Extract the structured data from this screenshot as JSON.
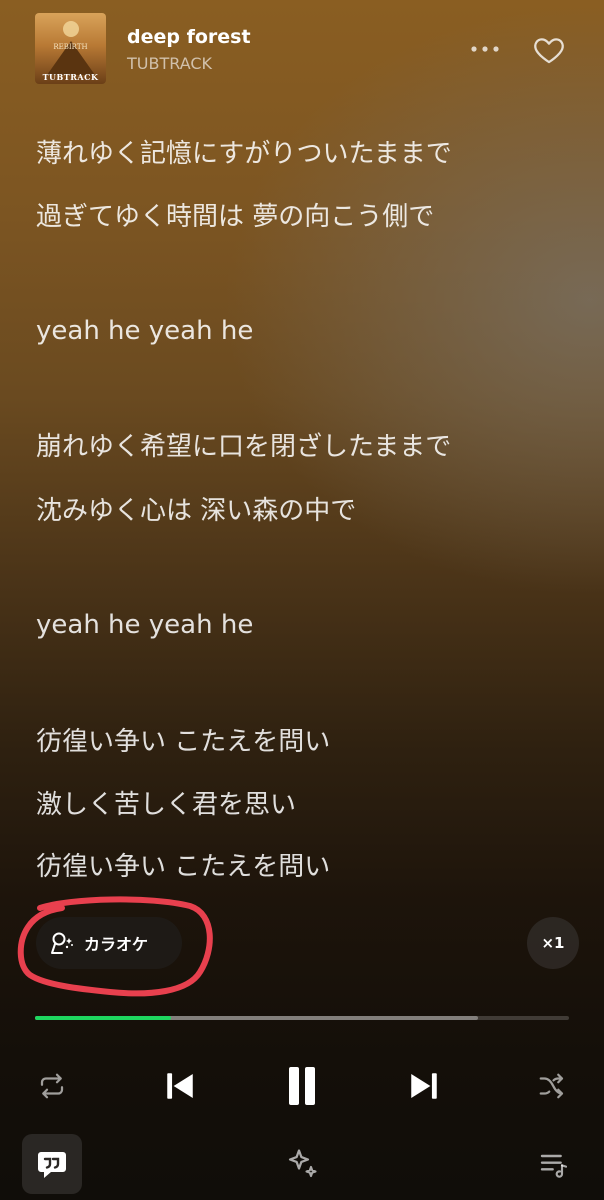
{
  "track": {
    "title": "deep forest",
    "artist": "TUBTRACK",
    "cover_title": "REBIRTH",
    "cover_logo": "TUBTRACK"
  },
  "lyrics": [
    "薄れゆく記憶にすがりついたままで",
    "過ぎてゆく時間は 夢の向こう側で",
    "yeah he yeah he",
    "崩れゆく希望に口を閉ざしたままで",
    "沈みゆく心は 深い森の中で",
    "yeah he yeah he",
    "彷徨い争い こたえを問い",
    "激しく苦しく君を思い",
    "彷徨い争い こたえを問い"
  ],
  "karaoke": {
    "label": "カラオケ"
  },
  "speed": {
    "label": "×1"
  },
  "progress": {
    "played_fraction": 0.255,
    "buffered_fraction": 0.83
  },
  "colors": {
    "accent": "#1ed760",
    "annotation": "#e8404e"
  },
  "icons": {
    "more": "more-horizontal-icon",
    "favorite": "heart-outline-icon",
    "karaoke": "microphone-sparkle-icon",
    "repeat": "repeat-icon",
    "previous": "skip-previous-icon",
    "pause": "pause-icon",
    "next": "skip-next-icon",
    "shuffle": "shuffle-icon",
    "lyrics": "lyrics-quote-icon",
    "ai": "sparkle-icon",
    "queue": "queue-music-icon"
  }
}
